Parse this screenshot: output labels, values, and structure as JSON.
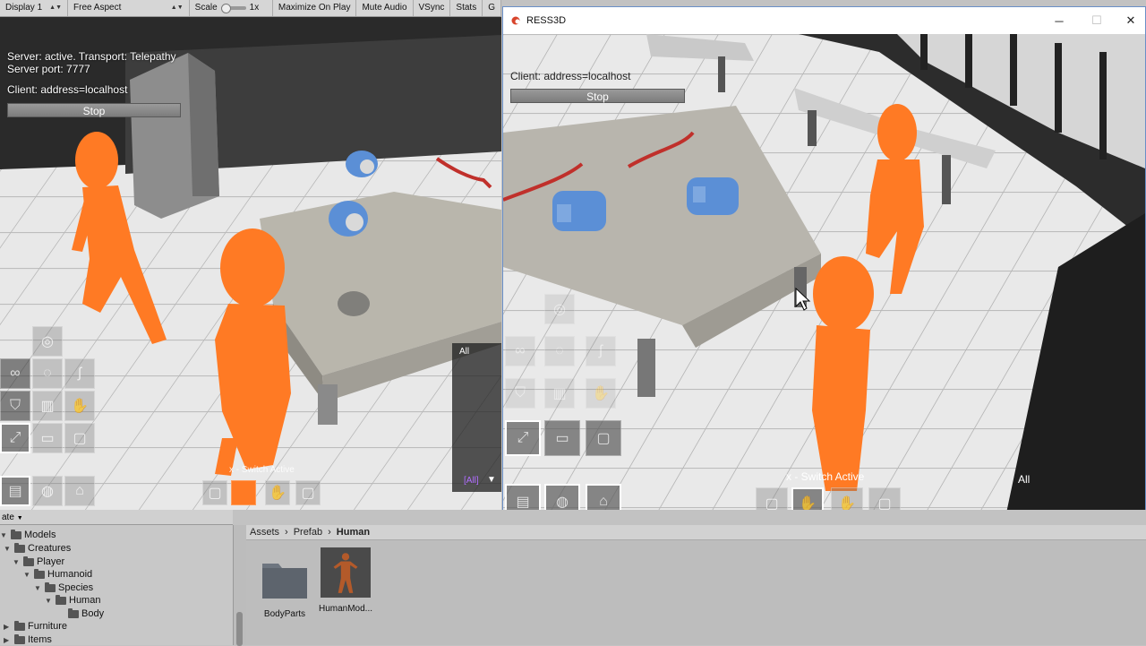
{
  "toolbar": {
    "display": "Display 1",
    "aspect": "Free Aspect",
    "scale_label": "Scale",
    "scale_value": "1x",
    "maximize": "Maximize On Play",
    "mute": "Mute Audio",
    "vsync": "VSync",
    "stats": "Stats",
    "gizmos": "G"
  },
  "host_view": {
    "server_status": "Server: active. Transport: Telepathy",
    "server_port": "Server port: 7777",
    "client_status": "Client: address=localhost",
    "stop_label": "Stop",
    "switch_hint": "x - Switch Active",
    "filter_label": "All",
    "filter_tag": "[All]"
  },
  "client_window": {
    "title": "RESS3D",
    "minimize": "─",
    "maximize": "☐",
    "close": "✕",
    "client_status": "Client: address=localhost",
    "stop_label": "Stop",
    "switch_hint": "x - Switch Active",
    "filter_label": "All"
  },
  "hierarchy": {
    "header": "ate",
    "items": [
      {
        "label": "Models"
      },
      {
        "label": "Creatures"
      },
      {
        "label": "Player"
      },
      {
        "label": "Humanoid"
      },
      {
        "label": "Species"
      },
      {
        "label": "Human"
      },
      {
        "label": "Body"
      },
      {
        "label": "Furniture"
      },
      {
        "label": "Items"
      }
    ]
  },
  "project": {
    "breadcrumb": [
      "Assets",
      "Prefab",
      "Human"
    ],
    "assets": [
      {
        "name": "BodyParts",
        "icon": "folder-icon"
      },
      {
        "name": "HumanMod...",
        "icon": "prefab-icon"
      }
    ]
  },
  "colors": {
    "character": "#ff7a24",
    "item_blue": "#5b8fd6",
    "accent_border": "#6a8fc7"
  }
}
